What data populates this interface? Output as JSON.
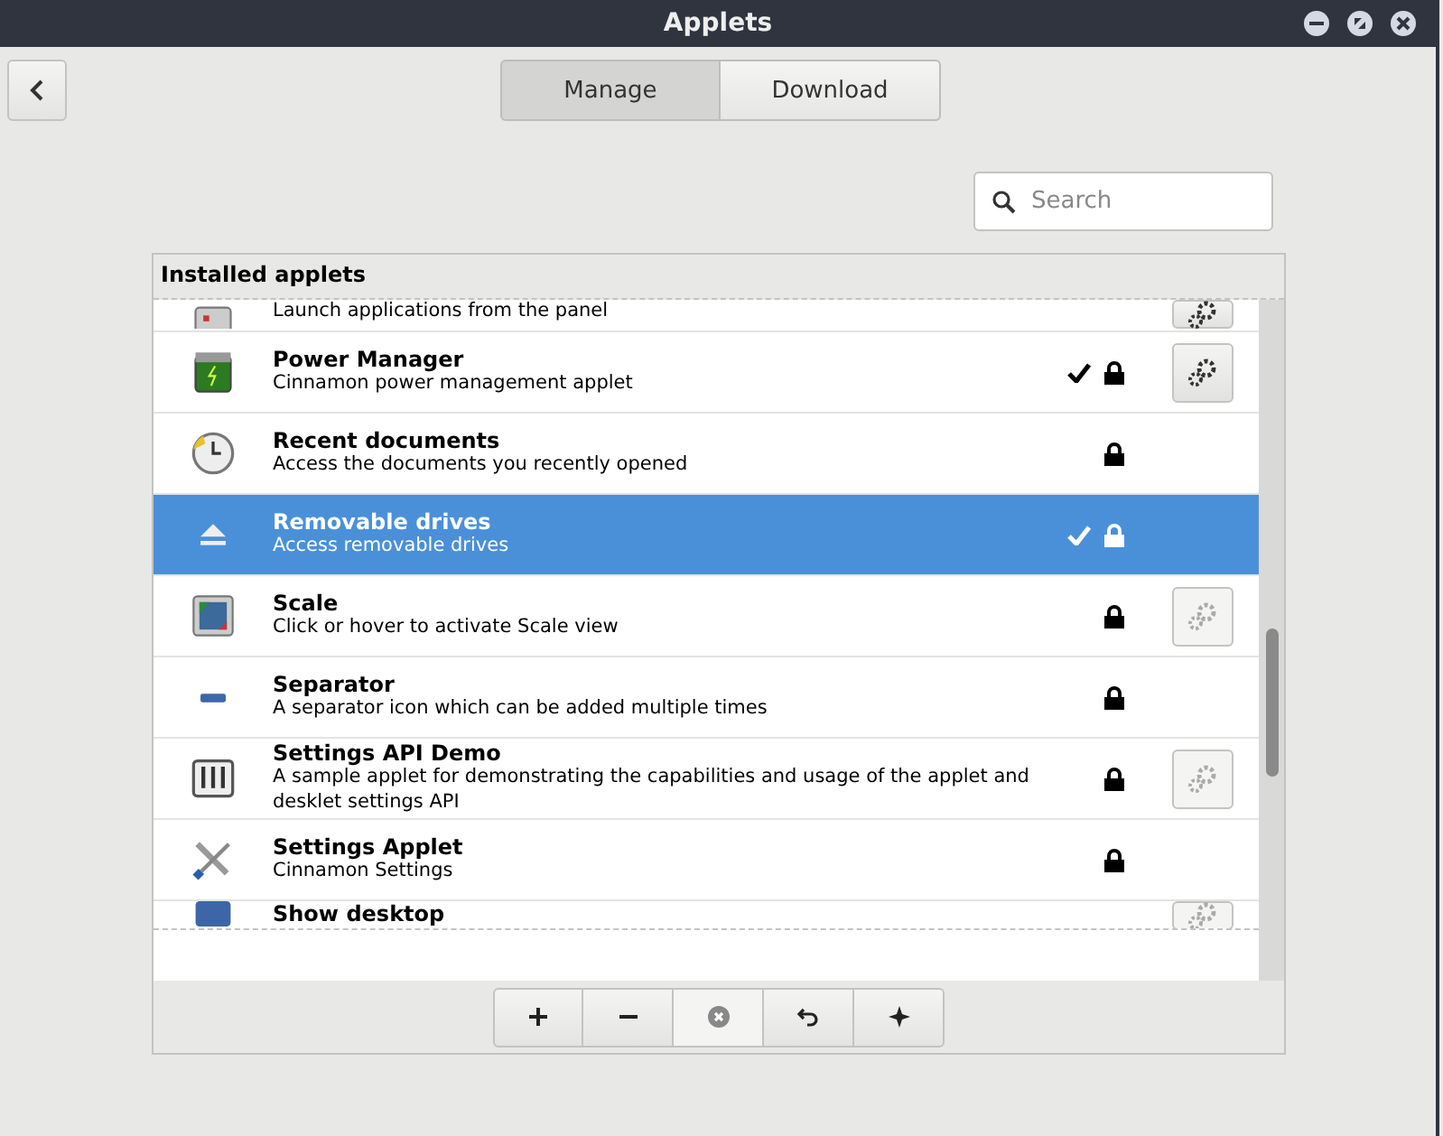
{
  "window": {
    "title": "Applets"
  },
  "tabs": [
    {
      "label": "Manage",
      "selected": true
    },
    {
      "label": "Download",
      "selected": false
    }
  ],
  "search": {
    "placeholder": "Search"
  },
  "list": {
    "heading": "Installed applets",
    "rows": [
      {
        "kind": "partial-top",
        "description": "Launch applications from the panel",
        "settings": {
          "disabled": false
        },
        "selected": false
      },
      {
        "kind": "full",
        "name": "Power Manager",
        "description": "Cinnamon power management applet",
        "enabled": true,
        "locked": true,
        "settings": {
          "disabled": false
        },
        "selected": false
      },
      {
        "kind": "full",
        "name": "Recent documents",
        "description": "Access the documents you recently opened",
        "enabled": false,
        "locked": true,
        "selected": false
      },
      {
        "kind": "full",
        "name": "Removable drives",
        "description": "Access removable drives",
        "enabled": true,
        "locked": true,
        "selected": true
      },
      {
        "kind": "full",
        "name": "Scale",
        "description": "Click or hover to activate Scale view",
        "enabled": false,
        "locked": true,
        "settings": {
          "disabled": true
        },
        "selected": false
      },
      {
        "kind": "full",
        "name": "Separator",
        "description": "A separator icon which can be added multiple times",
        "enabled": false,
        "locked": true,
        "selected": false
      },
      {
        "kind": "full",
        "name": "Settings API Demo",
        "description": "A sample applet for demonstrating the capabilities and usage of the applet and desklet settings API",
        "enabled": false,
        "locked": true,
        "settings": {
          "disabled": true
        },
        "selected": false
      },
      {
        "kind": "full",
        "name": "Settings Applet",
        "description": "Cinnamon Settings",
        "enabled": false,
        "locked": true,
        "selected": false
      },
      {
        "kind": "partial-bottom",
        "name": "Show desktop",
        "settings": {
          "disabled": true
        },
        "selected": false
      }
    ]
  },
  "toolbar": [
    {
      "kind": "add",
      "disabled": false
    },
    {
      "kind": "remove",
      "disabled": false
    },
    {
      "kind": "uninstall",
      "disabled": true
    },
    {
      "kind": "restore",
      "disabled": false
    },
    {
      "kind": "more",
      "disabled": false
    }
  ]
}
